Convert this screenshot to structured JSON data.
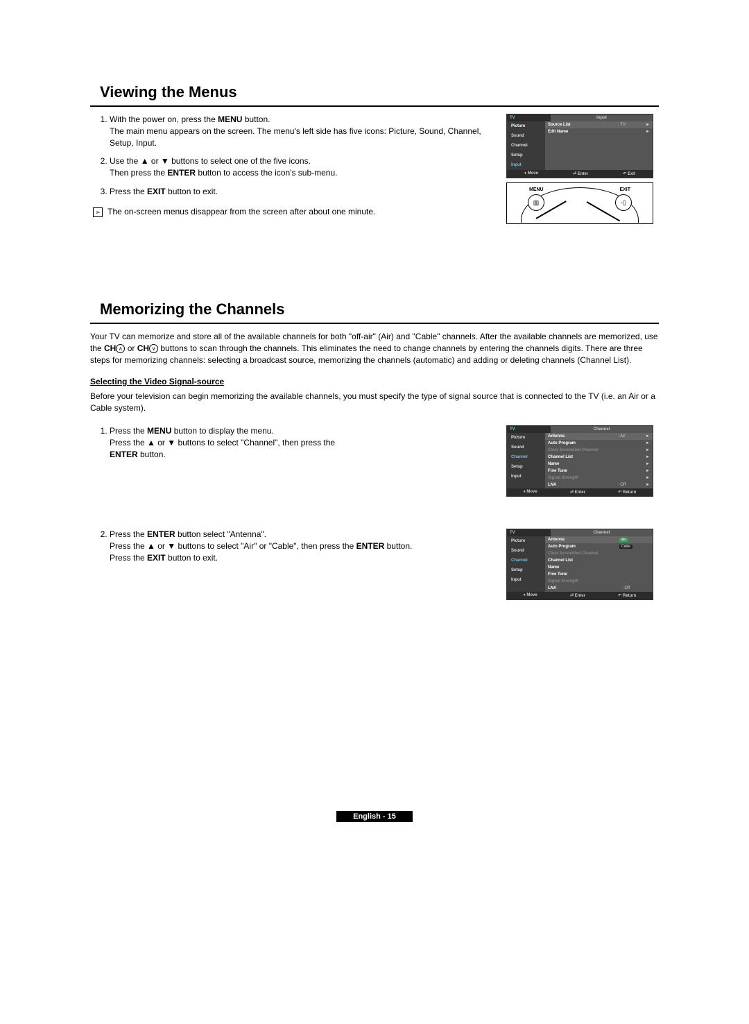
{
  "section1": {
    "title": "Viewing the Menus",
    "steps": [
      {
        "pre": "With the power on, press the ",
        "bold1": "MENU",
        "post1": " button.",
        "line2": "The main menu appears on the screen. The menu's left side has five icons: Picture, Sound, Channel, Setup, Input."
      },
      {
        "pre": "Use the ▲ or ▼ buttons to select one of the five icons.",
        "line2pre": "Then press the ",
        "line2bold": "ENTER",
        "line2post": " button to access the icon's sub-menu."
      },
      {
        "pre": "Press the ",
        "bold1": "EXIT",
        "post1": " button to exit."
      }
    ],
    "tip": "The on-screen menus disappear from the screen after about one minute.",
    "osd1": {
      "titleLeft": "TV",
      "titleRight": "Input",
      "side": [
        "Picture",
        "Sound",
        "Channel",
        "Setup",
        "Input"
      ],
      "items": [
        {
          "label": "Source List",
          "val": ": TV",
          "arrow": "►"
        },
        {
          "label": "Edit Name",
          "val": "",
          "arrow": "►"
        }
      ],
      "foot": {
        "move": "Move",
        "enter": "Enter",
        "exit": "Exit"
      }
    },
    "remote": {
      "menu": "MENU",
      "exit": "EXIT"
    }
  },
  "section2": {
    "title": "Memorizing the Channels",
    "intro_a": "Your TV can memorize and store all of the available channels for both \"off-air\" (Air) and \"Cable\" channels. After the available channels are memorized, use the ",
    "intro_ch1": "CH",
    "intro_or": " or ",
    "intro_ch2": "CH",
    "intro_b": " buttons to scan through the channels. This eliminates the need to change channels by entering the channels digits. There are three steps for memorizing channels: selecting a broadcast source, memorizing the channels (automatic) and adding or deleting channels (Channel List).",
    "sub": "Selecting the Video Signal-source",
    "before": "Before your television can begin memorizing the available channels, you must specify the type of signal source that is connected to the TV (i.e. an Air or a Cable system).",
    "step1": {
      "l1a": "Press the ",
      "l1b": "MENU",
      "l1c": " button to display the menu.",
      "l2": "Press the ▲ or ▼ buttons to select \"Channel\", then press the ",
      "l2b": "ENTER",
      "l2c": " button."
    },
    "step2": {
      "l1a": "Press the ",
      "l1b": "ENTER",
      "l1c": " button select \"Antenna\".",
      "l2a": "Press the ▲ or ▼ buttons to select \"Air\" or \"Cable\", then press the ",
      "l2b": "ENTER",
      "l2c": " button.",
      "l3a": "Press the ",
      "l3b": "EXIT",
      "l3c": " button to exit."
    },
    "osd2": {
      "titleLeft": "TV",
      "titleRight": "Channel",
      "side": [
        "Picture",
        "Sound",
        "Channel",
        "Setup",
        "Input"
      ],
      "items": [
        {
          "label": "Antenna",
          "val": ": Air",
          "arrow": "►",
          "hl": true
        },
        {
          "label": "Auto Program",
          "val": "",
          "arrow": "►"
        },
        {
          "label": "Clear Scrambled Channel",
          "dim": true,
          "arrow": "►"
        },
        {
          "label": "Channel List",
          "arrow": "►"
        },
        {
          "label": "Name",
          "arrow": "►"
        },
        {
          "label": "Fine Tune",
          "arrow": "►"
        },
        {
          "label": "Signal Strength",
          "dim": true,
          "arrow": "►"
        },
        {
          "label": "LNA",
          "val": ": Off",
          "arrow": "►"
        }
      ],
      "foot": {
        "move": "Move",
        "enter": "Enter",
        "ret": "Return"
      },
      "activeSide": "Channel"
    },
    "osd3": {
      "titleLeft": "TV",
      "titleRight": "Channel",
      "side": [
        "Picture",
        "Sound",
        "Channel",
        "Setup",
        "Input"
      ],
      "items": [
        {
          "label": "Antenna",
          "val": "",
          "arrow": "",
          "popup": [
            "Air",
            "Cable"
          ],
          "popupSel": "Air"
        },
        {
          "label": "Auto Program",
          "val": "",
          "arrow": ""
        },
        {
          "label": "Clear Scrambled Channel",
          "dim": true
        },
        {
          "label": "Channel List"
        },
        {
          "label": "Name"
        },
        {
          "label": "Fine Tune"
        },
        {
          "label": "Signal Strength",
          "dim": true
        },
        {
          "label": "LNA",
          "val": ": Off"
        }
      ],
      "foot": {
        "move": "Move",
        "enter": "Enter",
        "ret": "Return"
      },
      "activeSide": "Channel"
    }
  },
  "pageFoot": "English - 15"
}
